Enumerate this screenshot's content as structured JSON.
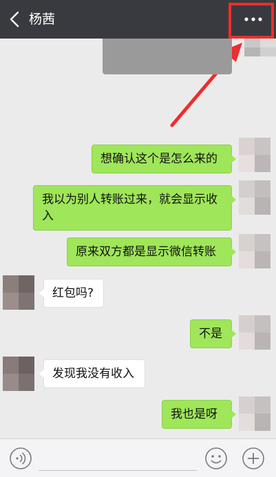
{
  "header": {
    "title": "杨茜"
  },
  "messages": [
    {
      "side": "right",
      "text": "想确认这个是怎么来的"
    },
    {
      "side": "right",
      "text": "我以为别人转账过来，就会显示收入"
    },
    {
      "side": "right",
      "text": "原来双方都是显示微信转账"
    },
    {
      "side": "left",
      "text": "红包吗?"
    },
    {
      "side": "right",
      "text": "不是"
    },
    {
      "side": "left",
      "text": "发现我没有收入"
    },
    {
      "side": "right",
      "text": "我也是呀"
    }
  ],
  "annotation": {
    "color": "#ee2d2d"
  },
  "colors": {
    "header_bg": "#393a3f",
    "bubble_self": "#9fe65a",
    "bubble_other": "#ffffff",
    "chat_bg": "#ebebeb"
  },
  "icons": [
    "back-icon",
    "more-icon",
    "voice-icon",
    "emoji-icon",
    "plus-icon"
  ]
}
